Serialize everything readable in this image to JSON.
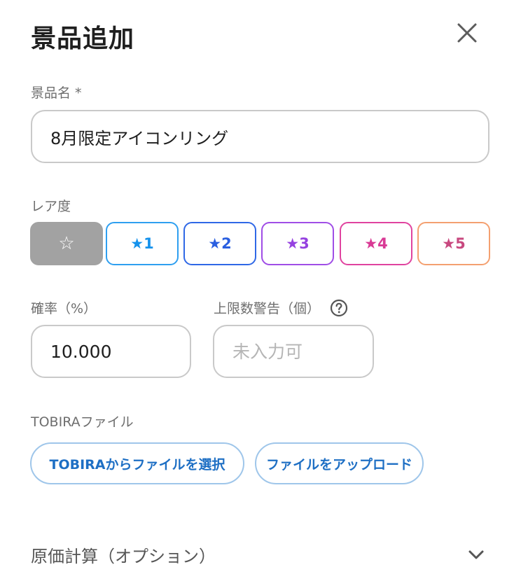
{
  "dialog": {
    "title": "景品追加",
    "close_icon": "close-icon"
  },
  "prize_name": {
    "label": "景品名 *",
    "value": "8月限定アイコンリング"
  },
  "rarity": {
    "label": "レア度",
    "options": [
      {
        "label": "☆",
        "color": "#a2a2a2",
        "selected": true
      },
      {
        "label": "★1",
        "color": "#1592ec"
      },
      {
        "label": "★2",
        "color": "#2a5fe0"
      },
      {
        "label": "★3",
        "color": "#9541e0"
      },
      {
        "label": "★4",
        "color": "#d93a95"
      },
      {
        "label": "★5",
        "color": "#c8487f"
      }
    ]
  },
  "probability": {
    "label": "確率（%）",
    "value": "10.000"
  },
  "limit_warning": {
    "label": "上限数警告（個）",
    "placeholder": "未入力可",
    "help_icon": "help-circle-icon"
  },
  "tobira_file": {
    "label": "TOBIRAファイル",
    "select_button": "TOBIRAからファイルを選択",
    "upload_button": "ファイルをアップロード"
  },
  "cost_calc": {
    "label": "原価計算（オプション）",
    "icon": "chevron-down-icon"
  },
  "colors": {
    "accent_blue": "#1e6fc4",
    "border_gray": "#c9c9c9"
  }
}
